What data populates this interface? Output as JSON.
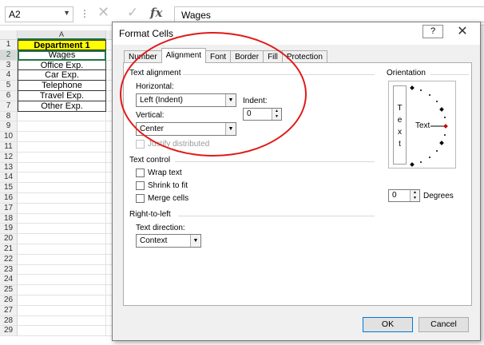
{
  "formula_bar": {
    "name_box": "A2",
    "name_box_arrow": "▼",
    "dots": "⋮",
    "cancel_icon": "✕",
    "enter_icon": "✓",
    "fx": "fx",
    "value": "Wages"
  },
  "sheet": {
    "column_header": "A",
    "rows": [
      "1",
      "2",
      "3",
      "4",
      "5",
      "6",
      "7",
      "8",
      "9",
      "10",
      "11",
      "12",
      "13",
      "14",
      "15",
      "16",
      "17",
      "18",
      "19",
      "20",
      "21",
      "22",
      "23",
      "24",
      "25",
      "26",
      "27",
      "28",
      "29"
    ],
    "cells": [
      "Department 1",
      "Wages",
      "Office Exp.",
      "Car Exp.",
      "Telephone",
      "Travel Exp.",
      "Other Exp."
    ],
    "header_fill": "#ffff00",
    "accent": "#217346"
  },
  "dialog": {
    "title": "Format Cells",
    "help": "?",
    "close": "✕",
    "tabs": [
      "Number",
      "Alignment",
      "Font",
      "Border",
      "Fill",
      "Protection"
    ],
    "active_tab": "Alignment",
    "text_alignment": {
      "section": "Text alignment",
      "horizontal_label": "Horizontal:",
      "horizontal_value": "Left (Indent)",
      "indent_label": "Indent:",
      "indent_value": "0",
      "vertical_label": "Vertical:",
      "vertical_value": "Center",
      "justify_distributed": "Justify distributed"
    },
    "text_control": {
      "section": "Text control",
      "wrap": "Wrap text",
      "shrink": "Shrink to fit",
      "merge": "Merge cells"
    },
    "rtl": {
      "section": "Right-to-left",
      "direction_label": "Text direction:",
      "direction_value": "Context"
    },
    "orientation": {
      "section": "Orientation",
      "vertical_text": [
        "T",
        "e",
        "x",
        "t"
      ],
      "dial_text": "Text",
      "degrees_value": "0",
      "degrees_label": "Degrees"
    },
    "ok": "OK",
    "cancel": "Cancel",
    "dropdown_arrow": "▼",
    "spin_up": "▲",
    "spin_down": "▼"
  },
  "annotation_color": "#e01a1a"
}
